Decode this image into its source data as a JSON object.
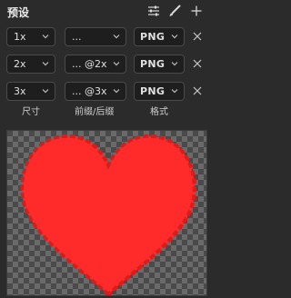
{
  "header": {
    "title": "预设",
    "icons": [
      "sliders-icon",
      "brush-icon",
      "add-icon"
    ]
  },
  "presets": [
    {
      "scale": "1x",
      "suffix": "...",
      "format": "PNG"
    },
    {
      "scale": "2x",
      "suffix": "... @2x",
      "format": "PNG"
    },
    {
      "scale": "3x",
      "suffix": "... @3x",
      "format": "PNG"
    }
  ],
  "columns": {
    "size": "尺寸",
    "prefix_suffix": "前缀/后缀",
    "format": "格式"
  },
  "preview": {
    "image": "red heart on transparent background",
    "heart_color": "#ff2a2a"
  }
}
